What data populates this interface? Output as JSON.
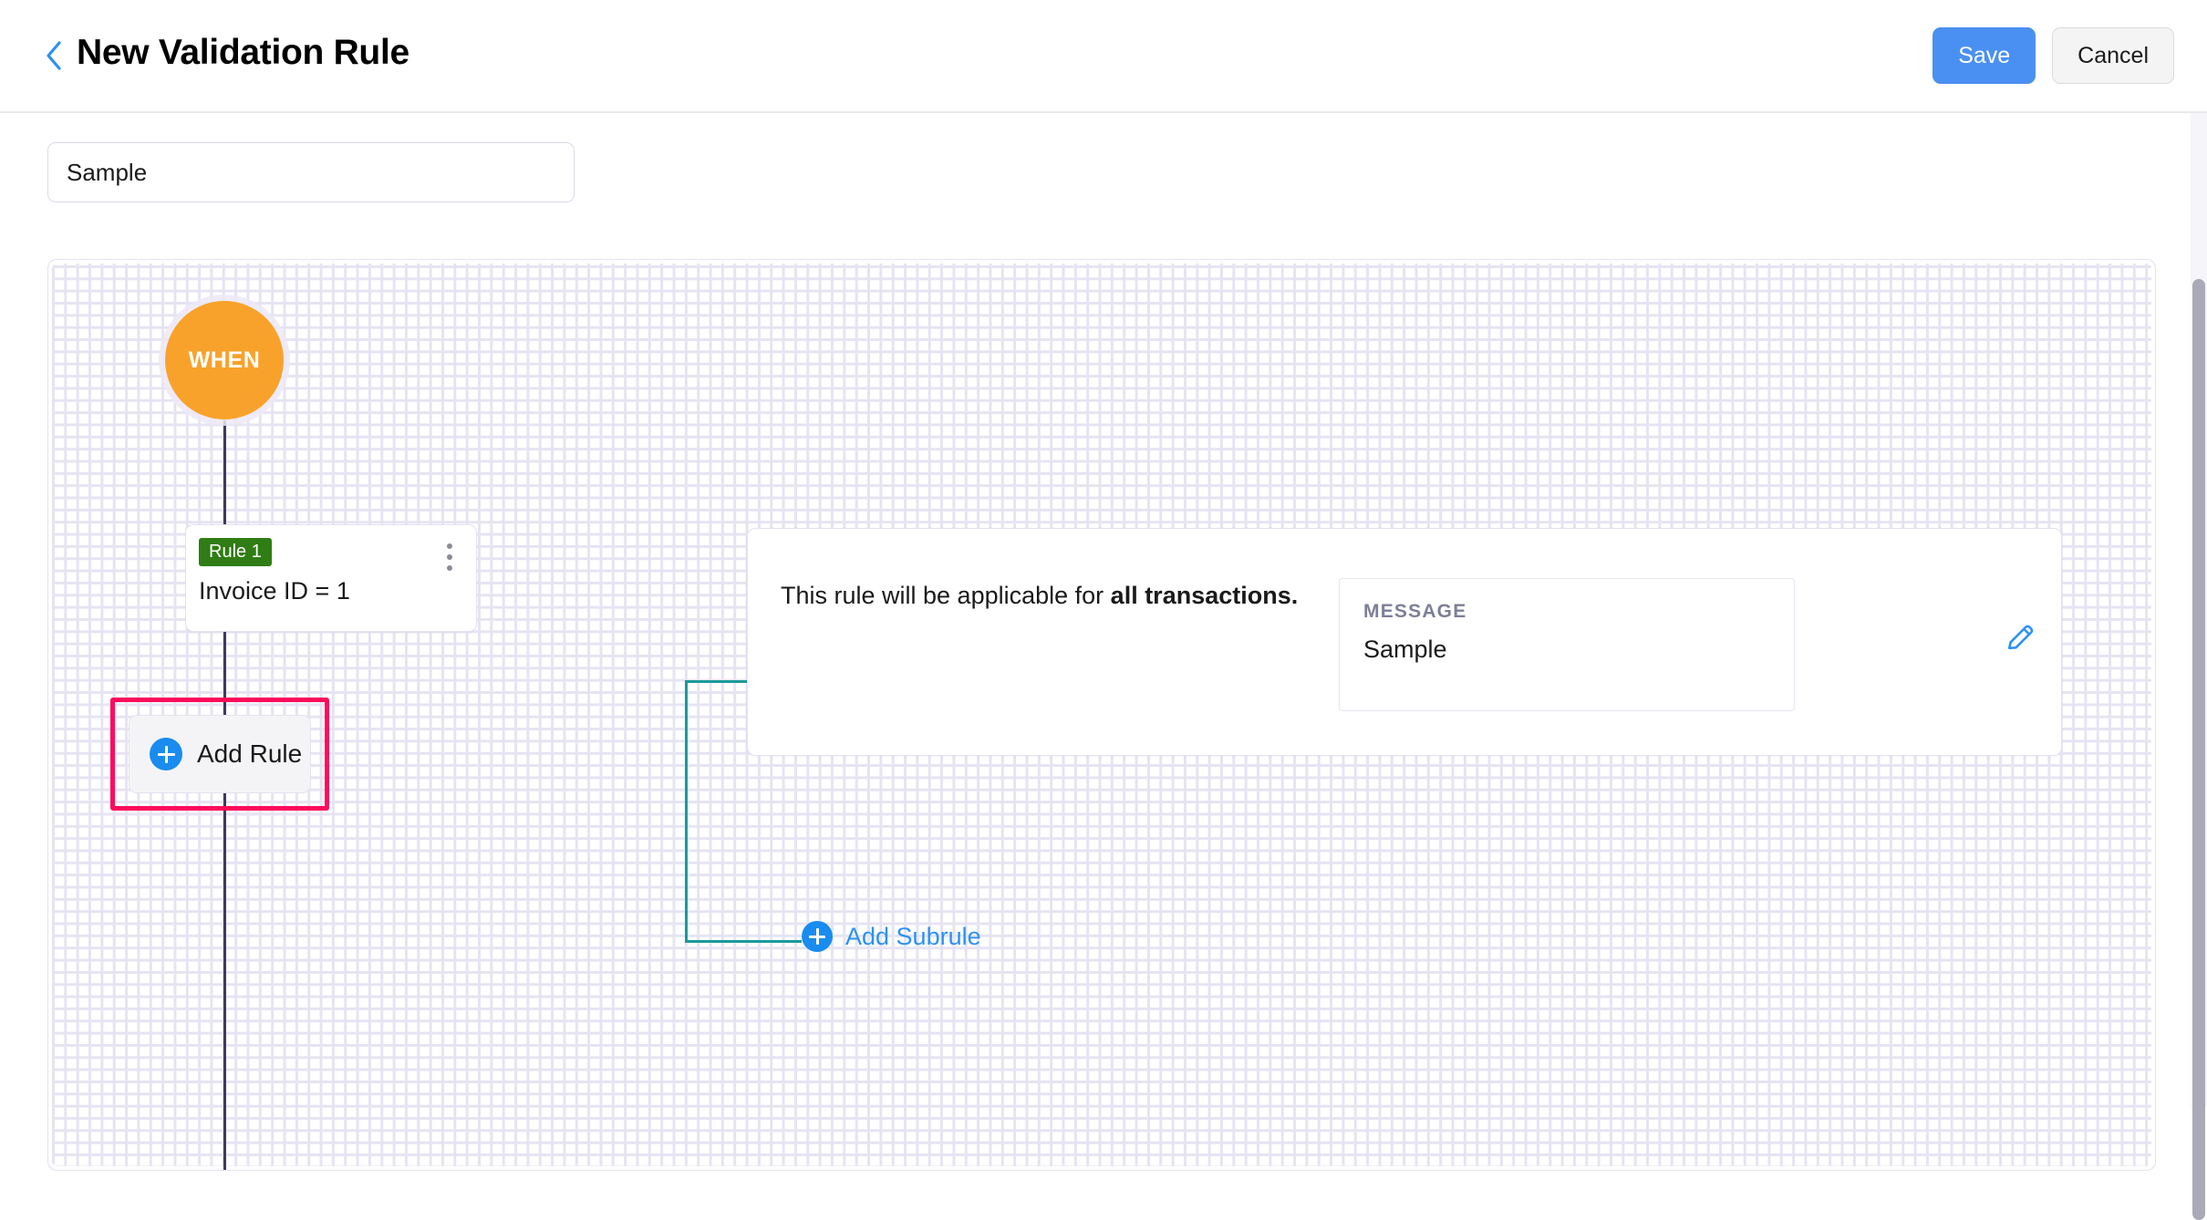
{
  "header": {
    "back_icon": "chevron-left-icon",
    "title": "New Validation Rule",
    "save_label": "Save",
    "cancel_label": "Cancel",
    "save_color": "#4a90f2",
    "cancel_color": "#f4f4f5"
  },
  "form": {
    "rule_name_value": "Sample",
    "rule_name_placeholder": "Rule Name"
  },
  "canvas": {
    "when_node": {
      "label": "WHEN",
      "color": "#f9a22b"
    },
    "rule_card": {
      "badge": "Rule 1",
      "badge_color": "#2f7d14",
      "expression": "Invoice ID = 1",
      "menu_icon": "kebab-menu-icon"
    },
    "info_panel": {
      "applicability_prefix": "This rule will be applicable for ",
      "applicability_emphasis": "all transactions.",
      "message_label": "MESSAGE",
      "message_value": "Sample",
      "edit_icon": "pencil-edit-icon",
      "edit_icon_color": "#2b91f5"
    },
    "add_subrule": {
      "label": "Add Subrule",
      "icon": "plus-circle-icon",
      "color": "#2b91f5"
    },
    "add_rule": {
      "label": "Add Rule",
      "icon": "plus-circle-icon",
      "highlight_color": "#ff0a5c"
    },
    "connector_color": "#1b9a9a",
    "trunk_color": "#3d3a5c"
  }
}
